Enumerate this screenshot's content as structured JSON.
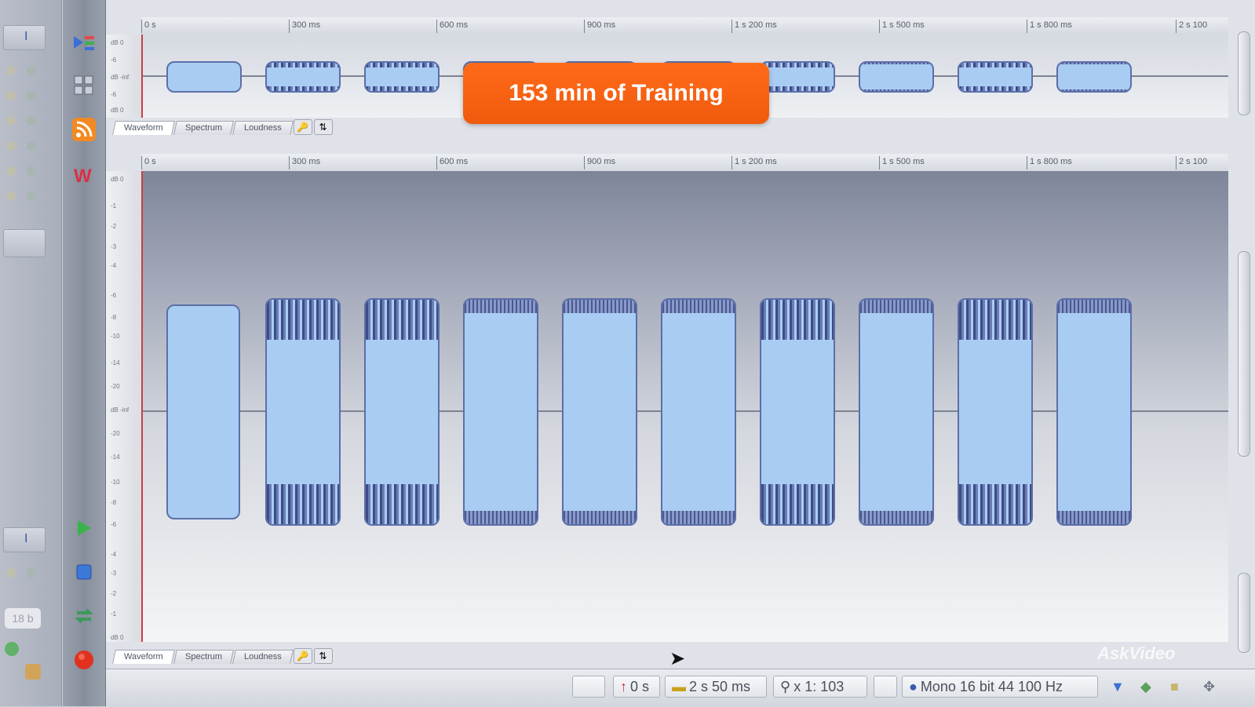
{
  "overlay": {
    "text": "153 min of Training"
  },
  "ruler": {
    "labels": [
      "0 s",
      "300 ms",
      "600 ms",
      "900 ms",
      "1 s 200 ms",
      "1 s 500 ms",
      "1 s 800 ms",
      "2 s 100"
    ]
  },
  "top_pane": {
    "yaxis_labels": [
      "dB 0",
      "-6",
      "dB -inf",
      "-6",
      "dB 0"
    ]
  },
  "bottom_pane": {
    "yaxis_labels": [
      "dB 0",
      "-1",
      "-2",
      "-3",
      "-4",
      "-6",
      "-8",
      "-10",
      "-14",
      "-20",
      "dB -inf",
      "-20",
      "-14",
      "-10",
      "-8",
      "-6",
      "-4",
      "-3",
      "-2",
      "-1",
      "dB 0"
    ]
  },
  "tabs": [
    "Waveform",
    "Spectrum",
    "Loudness"
  ],
  "status": {
    "start": "0 s",
    "length": "2 s 50 ms",
    "zoom": "x 1: 103",
    "format": "Mono 16 bit 44 100 Hz"
  },
  "left_panel": {
    "field_text": "18 b"
  },
  "watermark": "AskVideo",
  "colors": {
    "accent": "#ef5a0c",
    "waveform": "#a9cdf2",
    "waveform_edge": "#3e4c86"
  },
  "icons": {
    "toolbar": [
      "effects-icon",
      "grid-icon",
      "rss-icon",
      "w-logo-icon",
      "play-icon",
      "stop-icon",
      "loop-icon",
      "record-icon"
    ]
  }
}
